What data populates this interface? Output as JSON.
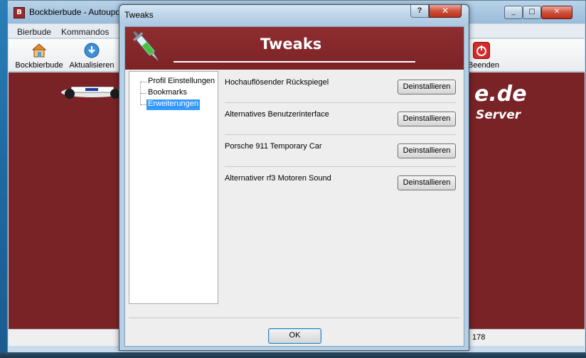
{
  "main_window": {
    "app_icon_letter": "B",
    "title": "Bockbierbude - Autoupdate",
    "menu": [
      "Bierbude",
      "Kommandos"
    ],
    "toolbar": [
      {
        "label": "Bockbierbude",
        "icon": "home-icon"
      },
      {
        "label": "Aktualisieren",
        "icon": "refresh-icon"
      },
      {
        "label": "Beenden",
        "icon": "power-icon"
      }
    ],
    "banner_line1": "e.de",
    "banner_line2": "Server",
    "status_value": "178",
    "window_buttons": {
      "minimize": "_",
      "maximize": "□",
      "close": "✕"
    }
  },
  "dialog": {
    "title": "Tweaks",
    "help_label": "?",
    "close_label": "✕",
    "header_title": "Tweaks",
    "tree": [
      {
        "label": "Profil Einstellungen",
        "selected": false
      },
      {
        "label": "Bookmarks",
        "selected": false
      },
      {
        "label": "Erweiterungen",
        "selected": true
      }
    ],
    "tweaks": [
      {
        "label": "Hochauflösender Rückspiegel",
        "button": "Deinstallieren"
      },
      {
        "label": "Alternatives Benutzerinterface",
        "button": "Deinstallieren"
      },
      {
        "label": "Porsche 911 Temporary Car",
        "button": "Deinstallieren"
      },
      {
        "label": "Alternativer rf3 Motoren Sound",
        "button": "Deinstallieren"
      }
    ],
    "ok_label": "OK"
  },
  "colors": {
    "banner": "#7a2326",
    "header": "#8f2d30",
    "selection": "#3399ff"
  }
}
